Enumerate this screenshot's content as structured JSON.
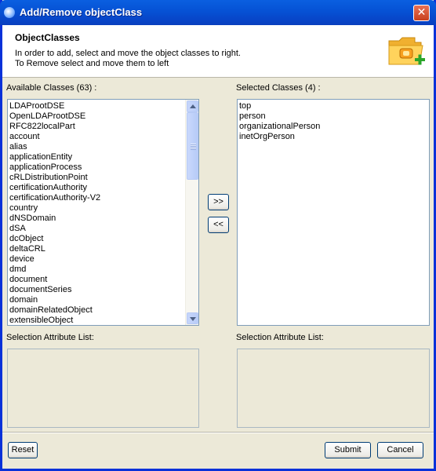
{
  "window": {
    "title": "Add/Remove objectClass",
    "close_label": "✕"
  },
  "header": {
    "title": "ObjectClasses",
    "line1": "In order to add, select and move the object classes to right.",
    "line2": "To Remove select and move them to left",
    "icon": "folder-add-icon"
  },
  "available": {
    "label": "Available Classes (63) :",
    "items": [
      "LDAProotDSE",
      "OpenLDAProotDSE",
      "RFC822localPart",
      "account",
      "alias",
      "applicationEntity",
      "applicationProcess",
      "cRLDistributionPoint",
      "certificationAuthority",
      "certificationAuthority-V2",
      "country",
      "dNSDomain",
      "dSA",
      "dcObject",
      "deltaCRL",
      "device",
      "dmd",
      "document",
      "documentSeries",
      "domain",
      "domainRelatedObject",
      "extensibleObject"
    ]
  },
  "selected": {
    "label": "Selected Classes (4) :",
    "items": [
      "top",
      "person",
      "organizationalPerson",
      "inetOrgPerson"
    ]
  },
  "move_right_label": ">>",
  "move_left_label": "<<",
  "attr_left": {
    "label": "Selection Attribute List:"
  },
  "attr_right": {
    "label": "Selection Attribute List:"
  },
  "buttons": {
    "reset": "Reset",
    "submit": "Submit",
    "cancel": "Cancel"
  }
}
